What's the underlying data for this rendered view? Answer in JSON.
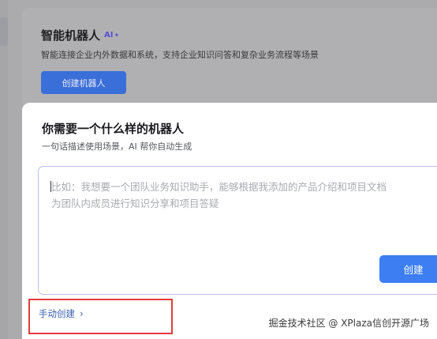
{
  "background_page": {
    "title": "智能机器人",
    "ai_badge": "AI",
    "ai_spark": "✦",
    "description": "智能连接企业内外数据和系统，支持企业知识问答和复杂业务流程等场景",
    "create_button": "创建机器人"
  },
  "modal": {
    "title": "你需要一个什么样的机器人",
    "subtitle": "一句话描述使用场景，AI 帮你自动生成",
    "prompt_placeholder": "比如：我想要一个团队业务知识助手，能够根据我添加的产品介绍和项目文档\n为团队内成员进行知识分享和项目答疑",
    "submit_button": "创建",
    "manual_create_link": "手动创建",
    "manual_create_chevron": "›"
  },
  "watermark": "掘金技术社区 @ XPlaza信创开源广场",
  "colors": {
    "accent": "#3d7ef2",
    "highlight_border": "#e23c3c",
    "ai_badge": "#5a4fd6",
    "link": "#3a5fb0"
  }
}
